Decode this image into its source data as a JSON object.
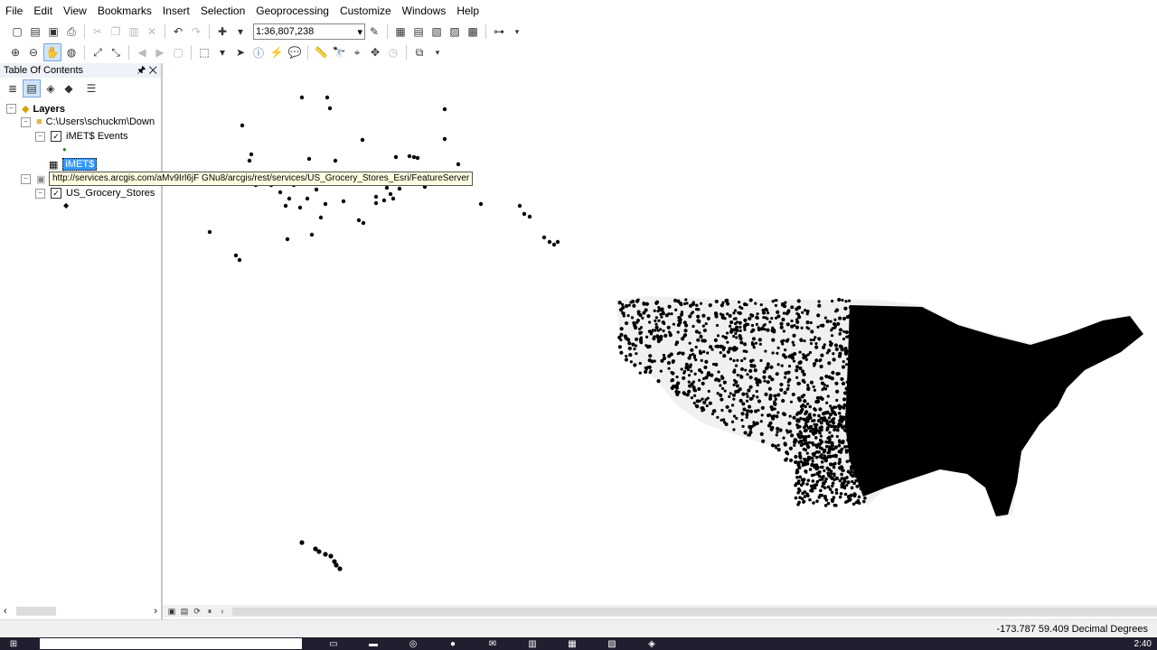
{
  "menu": [
    "File",
    "Edit",
    "View",
    "Bookmarks",
    "Insert",
    "Selection",
    "Geoprocessing",
    "Customize",
    "Windows",
    "Help"
  ],
  "toolbar": {
    "scale": "1:36,807,238"
  },
  "toc": {
    "title": "Table Of Contents",
    "layers_label": "Layers",
    "folder_path": "C:\\Users\\schuckm\\Down",
    "event_layer": "iMET$ Events",
    "table_name": "iMET$",
    "service_layer": "US_Grocery_Stores"
  },
  "tooltip": "http://services.arcgis.com/aMv9Irl6jF GNu8/arcgis/rest/services/US_Grocery_Stores_Esri/FeatureServer",
  "status": {
    "coords": "-173.787  59.409 Decimal Degrees"
  },
  "taskbar": {
    "clock": "2:40"
  },
  "colors": {
    "highlight": "#3399ff",
    "points": "#000000"
  }
}
